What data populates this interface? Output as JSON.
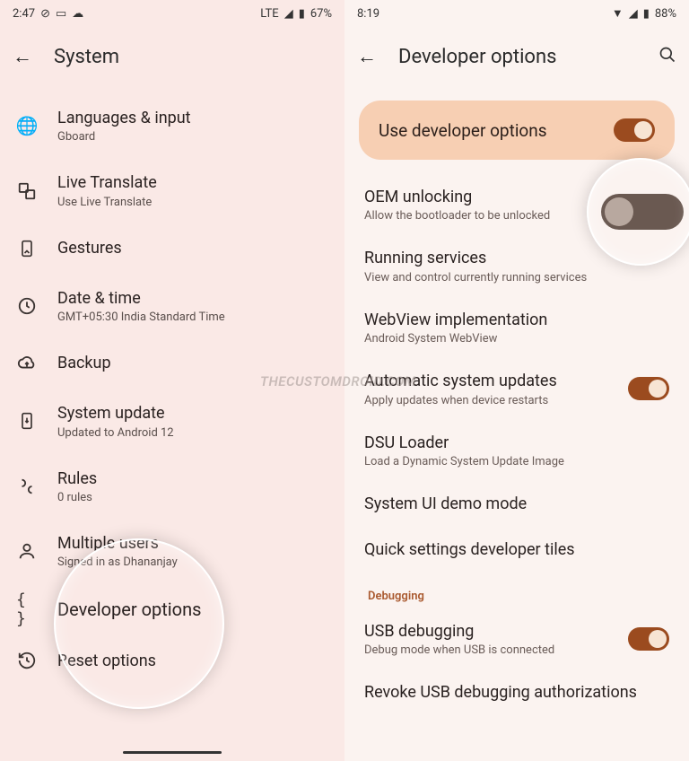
{
  "left": {
    "status": {
      "time": "2:47",
      "net": "LTE",
      "battery": "67%"
    },
    "header": {
      "title": "System"
    },
    "items": [
      {
        "icon": "globe",
        "title": "Languages & input",
        "sub": "Gboard"
      },
      {
        "icon": "translate",
        "title": "Live Translate",
        "sub": "Use Live Translate"
      },
      {
        "icon": "phone-swipe",
        "title": "Gestures",
        "sub": ""
      },
      {
        "icon": "clock",
        "title": "Date & time",
        "sub": "GMT+05:30 India Standard Time"
      },
      {
        "icon": "cloud-up",
        "title": "Backup",
        "sub": ""
      },
      {
        "icon": "phone-down",
        "title": "System update",
        "sub": "Updated to Android 12"
      },
      {
        "icon": "rules",
        "title": "Rules",
        "sub": "0 rules"
      },
      {
        "icon": "user",
        "title": "Multiple users",
        "sub": "Signed in as Dhananjay"
      },
      {
        "icon": "braces",
        "title": "Developer options",
        "sub": ""
      },
      {
        "icon": "history",
        "title": "Reset options",
        "sub": ""
      }
    ]
  },
  "right": {
    "status": {
      "time": "8:19",
      "battery": "88%"
    },
    "header": {
      "title": "Developer options"
    },
    "mainToggle": {
      "label": "Use developer options",
      "on": true
    },
    "items": [
      {
        "title": "OEM unlocking",
        "sub": "Allow the bootloader to be unlocked",
        "toggle": "spotlight"
      },
      {
        "title": "Running services",
        "sub": "View and control currently running services"
      },
      {
        "title": "WebView implementation",
        "sub": "Android System WebView"
      },
      {
        "title": "Automatic system updates",
        "sub": "Apply updates when device restarts",
        "toggle": "on"
      },
      {
        "title": "DSU Loader",
        "sub": "Load a Dynamic System Update Image"
      },
      {
        "title": "System UI demo mode",
        "sub": ""
      },
      {
        "title": "Quick settings developer tiles",
        "sub": ""
      }
    ],
    "sectionDebug": "Debugging",
    "debugItems": [
      {
        "title": "USB debugging",
        "sub": "Debug mode when USB is connected",
        "toggle": "on"
      },
      {
        "title": "Revoke USB debugging authorizations",
        "sub": ""
      }
    ]
  },
  "watermark": "thecustomdroid.com"
}
